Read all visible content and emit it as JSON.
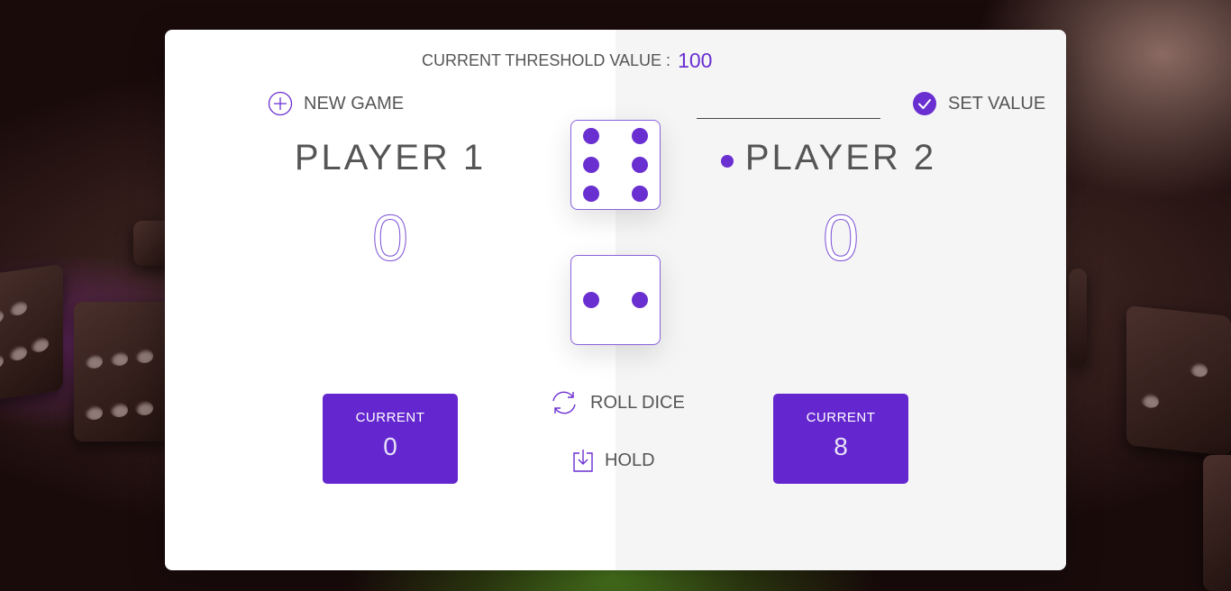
{
  "threshold": {
    "label": "CURRENT THRESHOLD VALUE :",
    "value": "100"
  },
  "controls": {
    "new_game": "NEW GAME",
    "set_value": "SET VALUE",
    "roll_dice": "ROLL DICE",
    "hold": "HOLD",
    "value_input": ""
  },
  "players": [
    {
      "name": "PLAYER 1",
      "score": "0",
      "current_label": "CURRENT",
      "current": "0",
      "active": false
    },
    {
      "name": "PLAYER 2",
      "score": "0",
      "current_label": "CURRENT",
      "current": "8",
      "active": true
    }
  ],
  "dice": [
    6,
    2
  ],
  "colors": {
    "accent": "#6427cf",
    "pip": "#6a2fd0"
  },
  "icons": {
    "new_game": "plus-circle-icon",
    "set_value": "check-circle-icon",
    "roll_dice": "refresh-icon",
    "hold": "download-icon"
  }
}
